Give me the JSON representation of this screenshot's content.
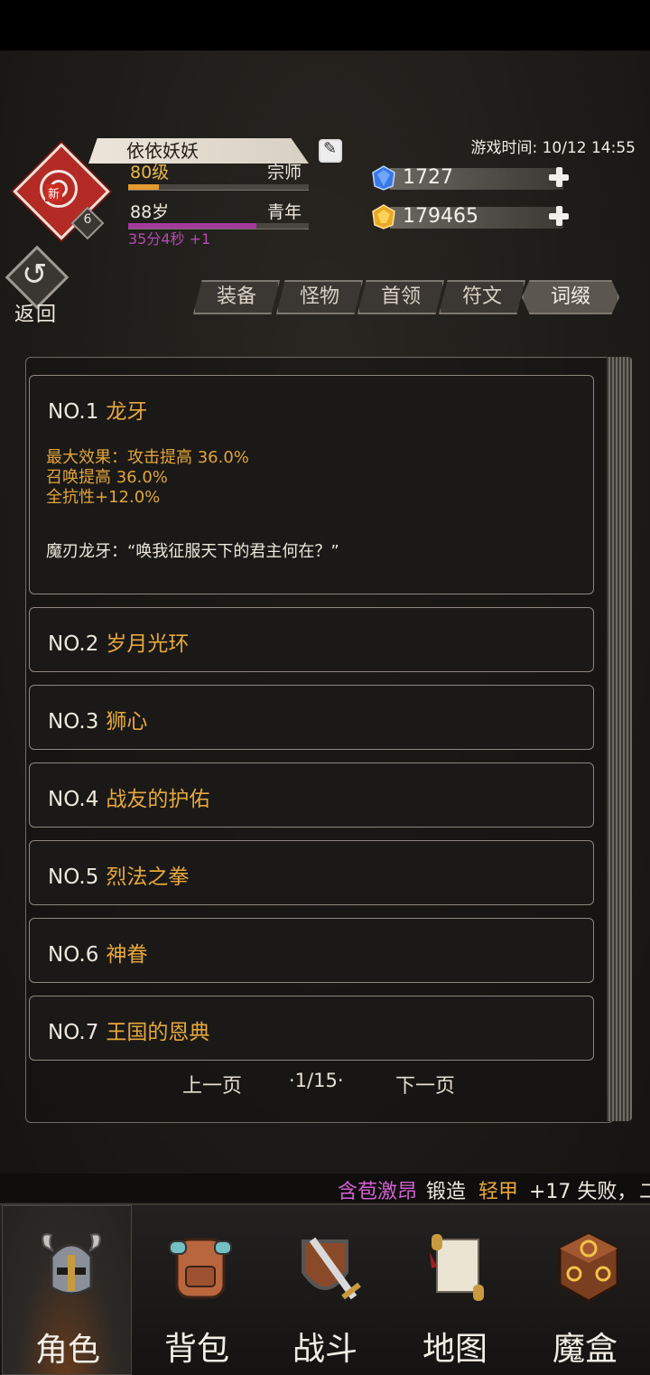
{
  "profile": {
    "name": "依依妖妖",
    "new_tag": "新",
    "badge_level": "6",
    "level_text": "80级",
    "rank": "宗师",
    "level_progress": 0.17,
    "age_text": "88岁",
    "age_stage": "青年",
    "age_progress": 0.71,
    "age_timer": "35分4秒 +1"
  },
  "game_time": "游戏时间: 10/12 14:55",
  "resources": {
    "gems": "1727",
    "gold": "179465"
  },
  "back_label": "返回",
  "tabs": [
    "装备",
    "怪物",
    "首领",
    "符文",
    "词缀"
  ],
  "active_tab_index": 4,
  "entries": [
    {
      "no": "NO.1",
      "title": "龙牙",
      "effects": [
        "最大效果：攻击提高 36.0%",
        "召唤提高 36.0%",
        "全抗性+12.0%"
      ],
      "quote": "魔刃龙牙：“唤我征服天下的君主何在？”"
    },
    {
      "no": "NO.2",
      "title": "岁月光环"
    },
    {
      "no": "NO.3",
      "title": "狮心"
    },
    {
      "no": "NO.4",
      "title": "战友的护佑"
    },
    {
      "no": "NO.5",
      "title": "烈法之拳"
    },
    {
      "no": "NO.6",
      "title": "神眷"
    },
    {
      "no": "NO.7",
      "title": "王国的恩典"
    }
  ],
  "pager": {
    "prev": "上一页",
    "page": "·1/15·",
    "next": "下一页"
  },
  "ticker": {
    "player": "含苞激昂",
    "action": "锻造",
    "item": "轻甲",
    "result": "+17 失败，",
    "tail": "二"
  },
  "nav": [
    "角色",
    "背包",
    "战斗",
    "地图",
    "魔盒"
  ],
  "colors": {
    "accent_gold": "#e7a83d",
    "level_bar": "#e69a2e",
    "age_bar": "#a43a9c",
    "ticker_player": "#d45fd2"
  }
}
